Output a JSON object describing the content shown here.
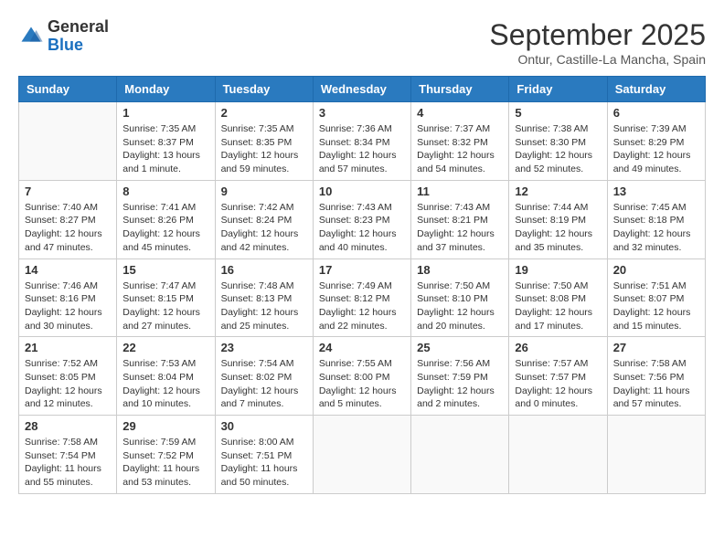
{
  "header": {
    "logo_general": "General",
    "logo_blue": "Blue",
    "month": "September 2025",
    "location": "Ontur, Castille-La Mancha, Spain"
  },
  "weekdays": [
    "Sunday",
    "Monday",
    "Tuesday",
    "Wednesday",
    "Thursday",
    "Friday",
    "Saturday"
  ],
  "weeks": [
    [
      {
        "day": "",
        "info": ""
      },
      {
        "day": "1",
        "info": "Sunrise: 7:35 AM\nSunset: 8:37 PM\nDaylight: 13 hours\nand 1 minute."
      },
      {
        "day": "2",
        "info": "Sunrise: 7:35 AM\nSunset: 8:35 PM\nDaylight: 12 hours\nand 59 minutes."
      },
      {
        "day": "3",
        "info": "Sunrise: 7:36 AM\nSunset: 8:34 PM\nDaylight: 12 hours\nand 57 minutes."
      },
      {
        "day": "4",
        "info": "Sunrise: 7:37 AM\nSunset: 8:32 PM\nDaylight: 12 hours\nand 54 minutes."
      },
      {
        "day": "5",
        "info": "Sunrise: 7:38 AM\nSunset: 8:30 PM\nDaylight: 12 hours\nand 52 minutes."
      },
      {
        "day": "6",
        "info": "Sunrise: 7:39 AM\nSunset: 8:29 PM\nDaylight: 12 hours\nand 49 minutes."
      }
    ],
    [
      {
        "day": "7",
        "info": "Sunrise: 7:40 AM\nSunset: 8:27 PM\nDaylight: 12 hours\nand 47 minutes."
      },
      {
        "day": "8",
        "info": "Sunrise: 7:41 AM\nSunset: 8:26 PM\nDaylight: 12 hours\nand 45 minutes."
      },
      {
        "day": "9",
        "info": "Sunrise: 7:42 AM\nSunset: 8:24 PM\nDaylight: 12 hours\nand 42 minutes."
      },
      {
        "day": "10",
        "info": "Sunrise: 7:43 AM\nSunset: 8:23 PM\nDaylight: 12 hours\nand 40 minutes."
      },
      {
        "day": "11",
        "info": "Sunrise: 7:43 AM\nSunset: 8:21 PM\nDaylight: 12 hours\nand 37 minutes."
      },
      {
        "day": "12",
        "info": "Sunrise: 7:44 AM\nSunset: 8:19 PM\nDaylight: 12 hours\nand 35 minutes."
      },
      {
        "day": "13",
        "info": "Sunrise: 7:45 AM\nSunset: 8:18 PM\nDaylight: 12 hours\nand 32 minutes."
      }
    ],
    [
      {
        "day": "14",
        "info": "Sunrise: 7:46 AM\nSunset: 8:16 PM\nDaylight: 12 hours\nand 30 minutes."
      },
      {
        "day": "15",
        "info": "Sunrise: 7:47 AM\nSunset: 8:15 PM\nDaylight: 12 hours\nand 27 minutes."
      },
      {
        "day": "16",
        "info": "Sunrise: 7:48 AM\nSunset: 8:13 PM\nDaylight: 12 hours\nand 25 minutes."
      },
      {
        "day": "17",
        "info": "Sunrise: 7:49 AM\nSunset: 8:12 PM\nDaylight: 12 hours\nand 22 minutes."
      },
      {
        "day": "18",
        "info": "Sunrise: 7:50 AM\nSunset: 8:10 PM\nDaylight: 12 hours\nand 20 minutes."
      },
      {
        "day": "19",
        "info": "Sunrise: 7:50 AM\nSunset: 8:08 PM\nDaylight: 12 hours\nand 17 minutes."
      },
      {
        "day": "20",
        "info": "Sunrise: 7:51 AM\nSunset: 8:07 PM\nDaylight: 12 hours\nand 15 minutes."
      }
    ],
    [
      {
        "day": "21",
        "info": "Sunrise: 7:52 AM\nSunset: 8:05 PM\nDaylight: 12 hours\nand 12 minutes."
      },
      {
        "day": "22",
        "info": "Sunrise: 7:53 AM\nSunset: 8:04 PM\nDaylight: 12 hours\nand 10 minutes."
      },
      {
        "day": "23",
        "info": "Sunrise: 7:54 AM\nSunset: 8:02 PM\nDaylight: 12 hours\nand 7 minutes."
      },
      {
        "day": "24",
        "info": "Sunrise: 7:55 AM\nSunset: 8:00 PM\nDaylight: 12 hours\nand 5 minutes."
      },
      {
        "day": "25",
        "info": "Sunrise: 7:56 AM\nSunset: 7:59 PM\nDaylight: 12 hours\nand 2 minutes."
      },
      {
        "day": "26",
        "info": "Sunrise: 7:57 AM\nSunset: 7:57 PM\nDaylight: 12 hours\nand 0 minutes."
      },
      {
        "day": "27",
        "info": "Sunrise: 7:58 AM\nSunset: 7:56 PM\nDaylight: 11 hours\nand 57 minutes."
      }
    ],
    [
      {
        "day": "28",
        "info": "Sunrise: 7:58 AM\nSunset: 7:54 PM\nDaylight: 11 hours\nand 55 minutes."
      },
      {
        "day": "29",
        "info": "Sunrise: 7:59 AM\nSunset: 7:52 PM\nDaylight: 11 hours\nand 53 minutes."
      },
      {
        "day": "30",
        "info": "Sunrise: 8:00 AM\nSunset: 7:51 PM\nDaylight: 11 hours\nand 50 minutes."
      },
      {
        "day": "",
        "info": ""
      },
      {
        "day": "",
        "info": ""
      },
      {
        "day": "",
        "info": ""
      },
      {
        "day": "",
        "info": ""
      }
    ]
  ]
}
